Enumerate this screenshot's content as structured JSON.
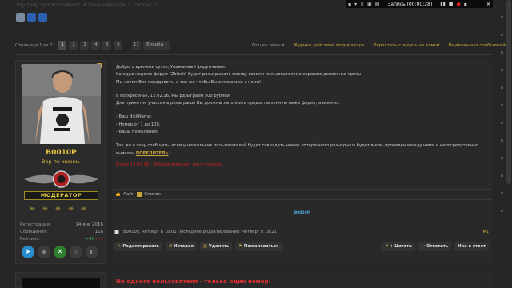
{
  "recorder": {
    "label": "Запись [00:00:28]"
  },
  "viewers_text": "Эту тему просматривают: 4 (пользователи: 3, гостей: 1)",
  "pagination": {
    "page_info": "Страница 1 из 11",
    "pages": [
      "1",
      "2",
      "3",
      "4",
      "5",
      "6",
      "…",
      "11"
    ],
    "next_label": "Вперёд ›"
  },
  "topmenu": {
    "options": "Опции темы ▾",
    "links": [
      "Журнал действий модератора",
      "Перестать следить за темой",
      "Выделенных сообщений: 0"
    ]
  },
  "user": {
    "name": "B0010P",
    "title": "Вор по жизни.",
    "banner": "МОДЕРАТОР",
    "stats": [
      {
        "k": "Регистрация:",
        "v": "14 янв 2016"
      },
      {
        "k": "Сообщения:",
        "v": "118"
      }
    ],
    "rating_label": "Рейтинг:",
    "rating_pos": "+46",
    "rating_neg": "/ -1"
  },
  "post": {
    "paragraphs": [
      "Доброго времени суток, Уважаемый форумчанин.",
      "Каждую неделю форум \"Zblock\" будет разыгрывать между своими пользователями хорошие денежные призы!",
      "Мы хотим Вас порадовать, а так же чтобы Вы оставались с нами!"
    ],
    "p2": [
      "В воскресенье, 12.02.16, Мы разыграем 500 рублей.",
      "Для принятия участия в розыгрыше Вы должны заполнить предоставленную ниже форму, а именно:"
    ],
    "form": [
      "- Ваш NickName:",
      "- Номер от 1 до 100.",
      "- Ваши пожелания:"
    ],
    "p3_line1": "Так же я хочу сообщить, если у нескольких пользователей будет совпадать номер лотерейного розыгрыша будет вновь проведен между ними и непосредственно",
    "p3_line2_pre": "выявлен",
    "winner": "ПОБЕДИТЕЛЬ",
    "red_line": "Итоги 12.02.16 - Победителей нет (нет голосов)"
  },
  "likes": {
    "text": "Лайк ",
    "list": "Список"
  },
  "signature": "B0010P",
  "meta": {
    "text": "B0010P, Четверг в 18:01   Последнее редактирование: Четверг в 18:21",
    "num": "#1"
  },
  "actions": {
    "left": [
      "Редактировать",
      "История",
      "Удалить",
      "Пожаловаться"
    ],
    "right": [
      "+ Цитата",
      "Ответить",
      "Ник в ответ"
    ]
  },
  "next_post": {
    "title": "На одного пользователя - только один номер!"
  },
  "colors": {
    "accent_gold": "#c9a43a",
    "warning_red": "#e03030",
    "online_green": "#4aa84a"
  }
}
